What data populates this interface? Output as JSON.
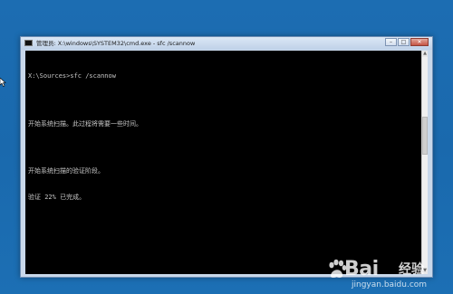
{
  "window": {
    "title": "管理员: X:\\windows\\SYSTEM32\\cmd.exe - sfc  /scannow",
    "controls": {
      "minimize_label": "–",
      "maximize_label": "□",
      "close_label": "✕"
    }
  },
  "console": {
    "lines": [
      "X:\\Sources>sfc /scannow",
      "",
      "开始系统扫描。此过程将需要一些时间。",
      "",
      "开始系统扫描的验证阶段。",
      "验证 22% 已完成。"
    ],
    "progress_percent": 22
  },
  "watermark": {
    "brand_latin": "Bai",
    "brand_suffix": "经验",
    "site": "jingyan.baidu.com",
    "paw_icon": "paw-icon"
  },
  "colors": {
    "desktop": "#1c6db2",
    "console_bg": "#000000",
    "console_fg": "#c6c6c6",
    "close_button": "#c65545"
  }
}
